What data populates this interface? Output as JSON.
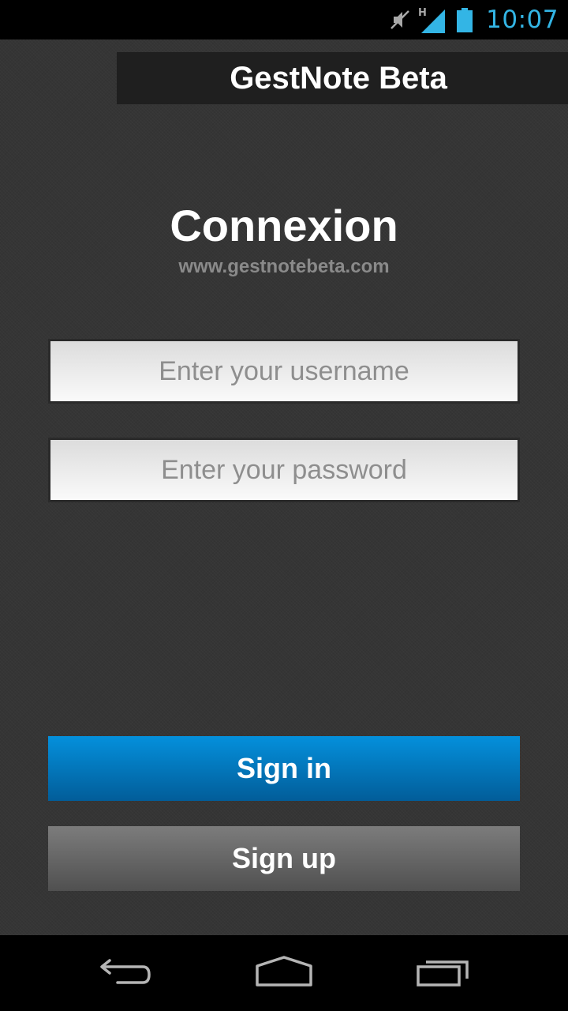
{
  "status_bar": {
    "time": "10:07",
    "network_type": "H",
    "icons": [
      "muted-icon",
      "signal-icon",
      "battery-icon"
    ],
    "accent_color": "#33b5e5"
  },
  "app": {
    "title": "GestNote Beta"
  },
  "login": {
    "heading": "Connexion",
    "website": "www.gestnotebeta.com",
    "username_placeholder": "Enter your username",
    "username_value": "",
    "password_placeholder": "Enter your password",
    "password_value": "",
    "signin_label": "Sign in",
    "signup_label": "Sign up"
  },
  "nav_bar": {
    "icons": [
      "back-icon",
      "home-icon",
      "recent-apps-icon"
    ]
  },
  "colors": {
    "background": "#353535",
    "title_bar": "#1f1f1f",
    "signin_button": "#0277bd",
    "signup_button": "#666666"
  }
}
